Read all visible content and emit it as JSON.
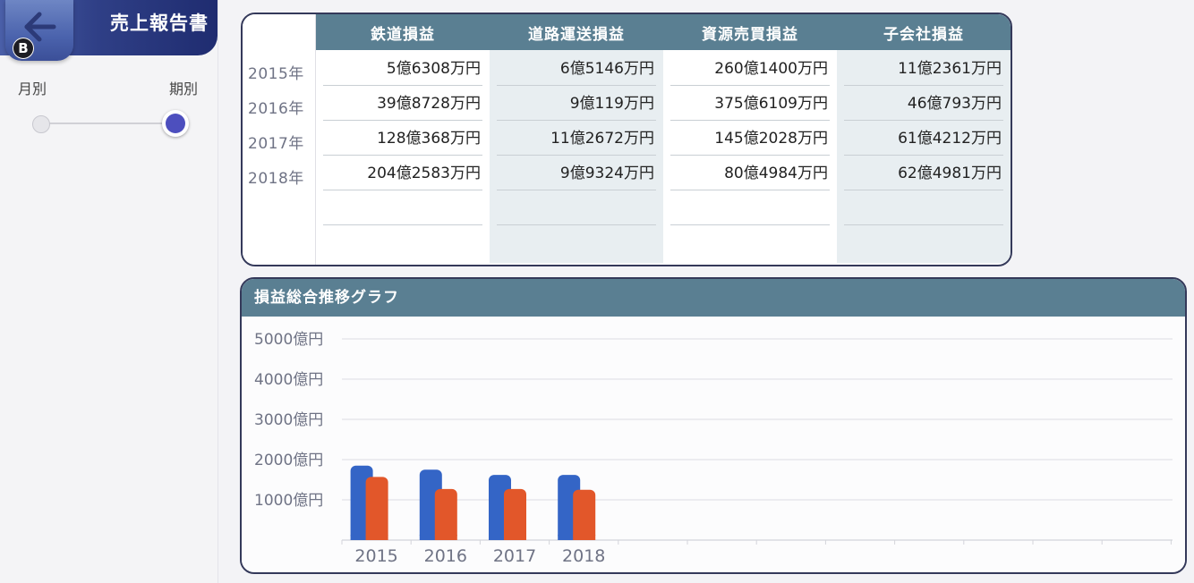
{
  "header": {
    "title": "売上報告書",
    "back_badge": "B"
  },
  "view_toggle": {
    "left_label": "月別",
    "right_label": "期別",
    "selected": "期別"
  },
  "table": {
    "years": [
      "2015年",
      "2016年",
      "2017年",
      "2018年"
    ],
    "columns": [
      {
        "header": "鉄道損益",
        "values": [
          "5億6308万円",
          "39億8728万円",
          "128億368万円",
          "204億2583万円"
        ]
      },
      {
        "header": "道路運送損益",
        "values": [
          "6億5146万円",
          "9億119万円",
          "11億2672万円",
          "9億9324万円"
        ]
      },
      {
        "header": "資源売買損益",
        "values": [
          "260億1400万円",
          "375億6109万円",
          "145億2028万円",
          "80億4984万円"
        ]
      },
      {
        "header": "子会社損益",
        "values": [
          "11億2361万円",
          "46億793万円",
          "61億4212万円",
          "62億4981万円"
        ]
      }
    ]
  },
  "chart_title": "損益総合推移グラフ",
  "chart_data": {
    "type": "bar",
    "categories": [
      "2015",
      "2016",
      "2017",
      "2018"
    ],
    "series": [
      {
        "values": [
          1850,
          1750,
          1620,
          1620
        ],
        "color": "#3465c6"
      },
      {
        "values": [
          1570,
          1270,
          1270,
          1250
        ],
        "color": "#e2572a"
      }
    ],
    "y_ticks": [
      "1000億円",
      "2000億円",
      "3000億円",
      "4000億円",
      "5000億円"
    ],
    "ylim": [
      0,
      5000
    ],
    "grid": true
  }
}
